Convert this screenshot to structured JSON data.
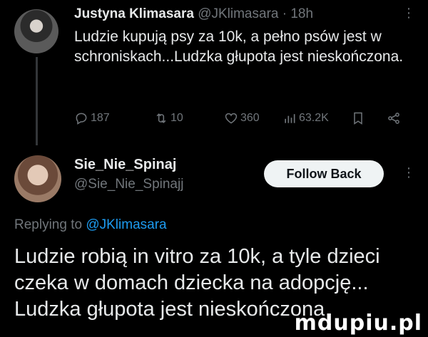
{
  "tweet1": {
    "name": "Justyna Klimasara",
    "handle": "@JKlimasara",
    "separator": "·",
    "time": "18h",
    "more": "⋮",
    "text": "Ludzie kupują psy za 10k, a pełno psów jest w schroniskach...Ludzka głupota jest nieskończona.",
    "actions": {
      "replies": "187",
      "reposts": "10",
      "likes": "360",
      "views": "63.2K"
    }
  },
  "tweet2": {
    "name": "Sie_Nie_Spinaj",
    "handle": "@Sie_Nie_Spinajj",
    "follow_label": "Follow Back",
    "more": "⋮",
    "replying_prefix": "Replying to",
    "replying_to": "@JKlimasara",
    "text": "Ludzie robią in vitro za 10k, a tyle dzieci czeka w domach dziecka na adopcję... Ludzka głupota jest nieskończona"
  },
  "watermark": "mdupiu.pl"
}
